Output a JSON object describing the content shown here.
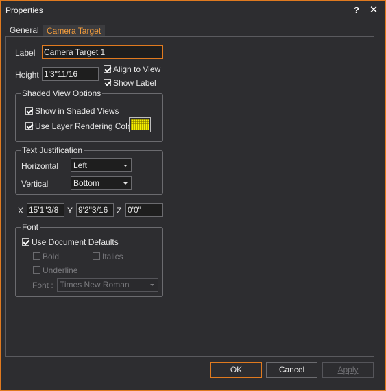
{
  "window": {
    "title": "Properties",
    "help": "?",
    "close": "✕"
  },
  "tabs": [
    {
      "label": "General"
    },
    {
      "label": "Camera Target"
    }
  ],
  "form": {
    "label_text": "Label",
    "label_value": "Camera Target 1",
    "height_text": "Height",
    "height_value": "1'3\"11/16",
    "align_to_view": {
      "label": "Align to View",
      "checked": true
    },
    "show_label": {
      "label": "Show Label",
      "checked": true
    }
  },
  "shaded": {
    "title": "Shaded View Options",
    "show_in_shaded": {
      "label": "Show in Shaded Views",
      "checked": true
    },
    "use_layer_color": {
      "label": "Use Layer Rendering Color",
      "checked": true
    },
    "swatch_color": "#f5f000"
  },
  "justification": {
    "title": "Text Justification",
    "horizontal_label": "Horizontal",
    "horizontal_value": "Left",
    "vertical_label": "Vertical",
    "vertical_value": "Bottom"
  },
  "coords": {
    "x_label": "X",
    "x_value": "15'1\"3/8",
    "y_label": "Y",
    "y_value": "9'2\"3/16",
    "z_label": "Z",
    "z_value": "0'0\""
  },
  "font": {
    "title": "Font",
    "use_defaults": {
      "label": "Use Document Defaults",
      "checked": true
    },
    "bold": "Bold",
    "italics": "Italics",
    "underline": "Underline",
    "font_label": "Font :",
    "font_value": "Times New Roman"
  },
  "buttons": {
    "ok": "OK",
    "cancel": "Cancel",
    "apply": "Apply"
  },
  "colors": {
    "accent": "#e07a1f",
    "background": "#2d2d30",
    "tab_active_text": "#f39c3b"
  }
}
